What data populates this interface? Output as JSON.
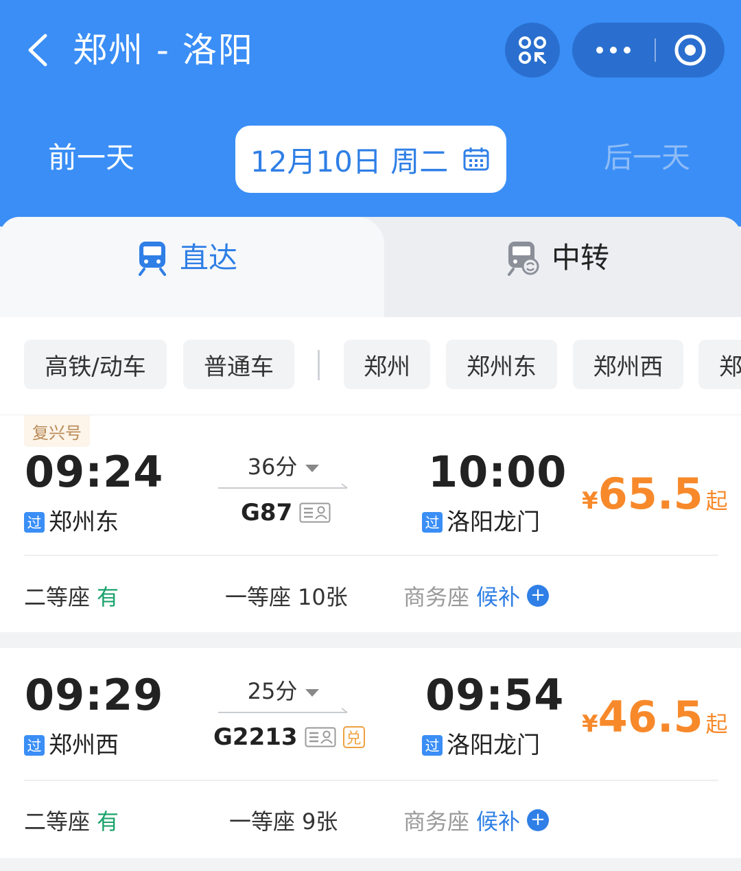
{
  "header": {
    "route_title": "郑州 - 洛阳",
    "prev_day": "前一天",
    "date": "12月10日 周二",
    "next_day": "后一天"
  },
  "tabs": [
    {
      "label": "直达",
      "active": true
    },
    {
      "label": "中转",
      "active": false
    }
  ],
  "filters": {
    "train_types": [
      "高铁/动车",
      "普通车"
    ],
    "stations": [
      "郑州",
      "郑州东",
      "郑州西",
      "郑"
    ]
  },
  "trains": [
    {
      "badge": "复兴号",
      "depart_time": "09:24",
      "depart_station": "郑州东",
      "pass_label": "过",
      "duration": "36分",
      "train_no": "G87",
      "arrive_time": "10:00",
      "arrive_station": "洛阳龙门",
      "price_currency": "¥",
      "price": "65.5",
      "price_suffix": "起",
      "seats": {
        "second_label": "二等座",
        "second_value": "有",
        "first_label": "一等座",
        "first_value": "10张",
        "business_label": "商务座",
        "business_value": "候补"
      }
    },
    {
      "depart_time": "09:29",
      "depart_station": "郑州西",
      "pass_label": "过",
      "duration": "25分",
      "train_no": "G2213",
      "exchange_label": "兑",
      "arrive_time": "09:54",
      "arrive_station": "洛阳龙门",
      "price_currency": "¥",
      "price": "46.5",
      "price_suffix": "起",
      "seats": {
        "second_label": "二等座",
        "second_value": "有",
        "first_label": "一等座",
        "first_value": "9张",
        "business_label": "商务座",
        "business_value": "候补"
      }
    }
  ],
  "colors": {
    "header_blue": "#3a8ef6",
    "accent_blue": "#2f7fe6",
    "price_orange": "#f7892b",
    "available_green": "#1aa36b"
  },
  "icons": [
    "back-arrow-icon",
    "scan-icon",
    "more-icon",
    "close-target-icon",
    "calendar-icon",
    "train-icon",
    "transfer-train-icon",
    "id-card-icon",
    "plus-icon"
  ]
}
